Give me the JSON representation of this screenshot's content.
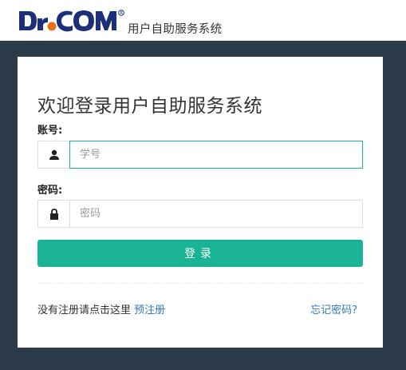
{
  "header": {
    "brand_name": "用户自助服务系统",
    "logo_alt": "Dr.COM"
  },
  "login": {
    "title": "欢迎登录用户自助服务系统",
    "account_label": "账号:",
    "account_placeholder": "学号",
    "account_value": "",
    "password_label": "密码:",
    "password_placeholder": "密码",
    "password_value": "",
    "submit_label": "登录"
  },
  "footer": {
    "no_register_text": "没有注册请点击这里",
    "register_link": "预注册",
    "forgot_link": "忘记密码?"
  },
  "colors": {
    "accent": "#1ab394",
    "link": "#337ab7",
    "background": "#2b3a48",
    "logo_blue": "#1b2f7a",
    "logo_orange": "#e8701a"
  }
}
